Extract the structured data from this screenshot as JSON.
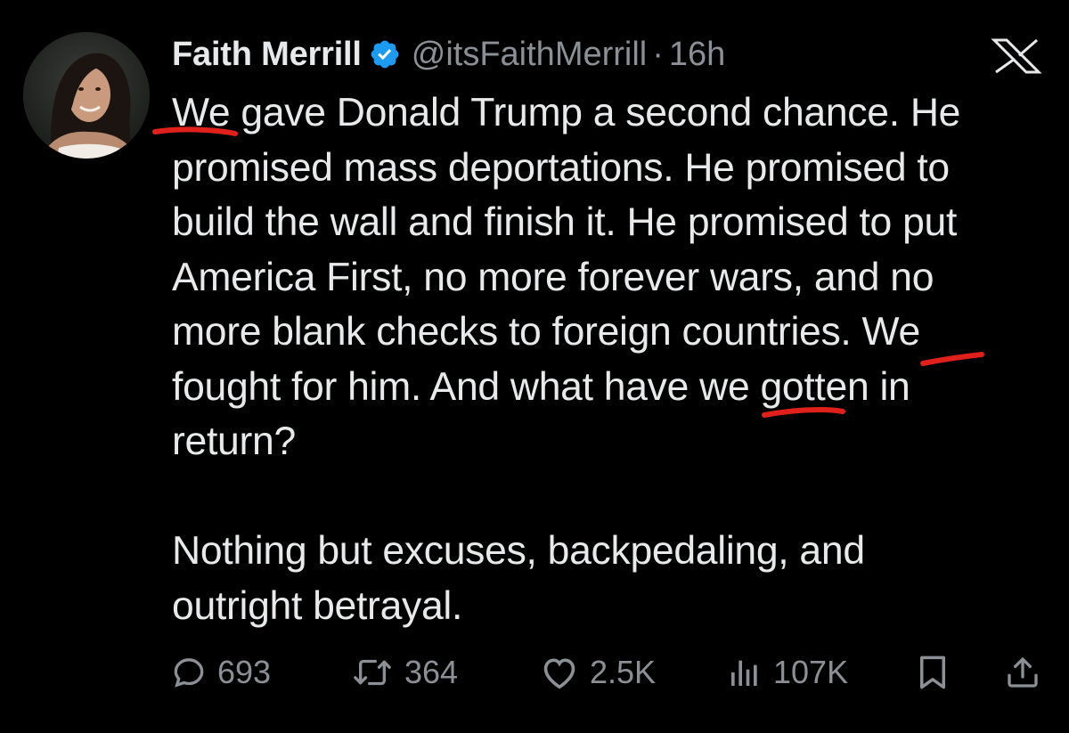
{
  "author": {
    "display_name": "Faith Merrill",
    "handle": "@itsFaithMerrill",
    "separator": "·",
    "time": "16h",
    "verified": true,
    "verified_color": "#1d9bf0"
  },
  "platform_logo": "x-logo",
  "tweet": {
    "paragraph_1": [
      "We gave Donald Trump a second chance. He",
      "promised mass deportations. He promised to",
      "build the wall and finish it. He promised to put",
      "America First, no more forever wars, and no",
      "more blank checks to foreign countries. We",
      "fought for him. And what have we gotten in",
      "return?"
    ],
    "paragraph_2": [
      "Nothing but excuses, backpedaling, and",
      "outright betrayal."
    ]
  },
  "annotation_color": "#e0201a",
  "actions": {
    "replies": {
      "icon": "reply-icon",
      "count": "693"
    },
    "reposts": {
      "icon": "repost-icon",
      "count": "364"
    },
    "likes": {
      "icon": "heart-icon",
      "count": "2.5K"
    },
    "views": {
      "icon": "views-chart-icon",
      "count": "107K"
    },
    "bookmark": {
      "icon": "bookmark-icon"
    },
    "share": {
      "icon": "share-icon"
    }
  },
  "colors": {
    "background": "#000000",
    "text": "#e7e9ea",
    "muted": "#8b9096"
  }
}
